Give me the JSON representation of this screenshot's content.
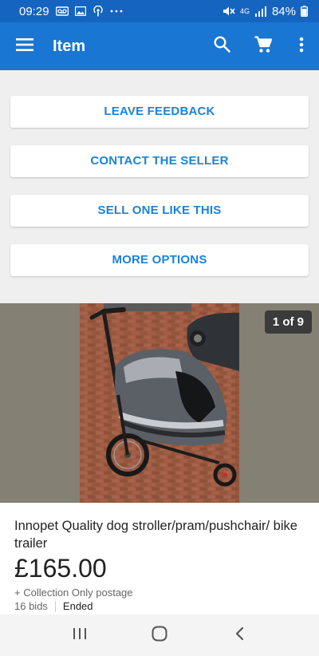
{
  "status_bar": {
    "time": "09:29",
    "battery": "84%",
    "network": "4G",
    "left_icons": [
      "voicemail-icon",
      "gallery-icon",
      "podcast-icon",
      "more-dots-icon"
    ],
    "right_icons": [
      "mute-icon",
      "signal-icon",
      "battery-icon"
    ]
  },
  "app_bar": {
    "title": "Item",
    "icons": [
      "menu-icon",
      "search-icon",
      "cart-icon",
      "more-vert-icon"
    ]
  },
  "options": [
    {
      "label": "LEAVE FEEDBACK"
    },
    {
      "label": "CONTACT THE SELLER"
    },
    {
      "label": "SELL ONE LIKE THIS"
    },
    {
      "label": "MORE OPTIONS"
    }
  ],
  "gallery": {
    "counter": "1 of 9",
    "current": 1,
    "total": 9
  },
  "item": {
    "title": "Innopet Quality dog stroller/pram/pushchair/ bike trailer",
    "price": "£165.00",
    "postage": "+ Collection Only postage",
    "bids": "16 bids",
    "status": "Ended"
  },
  "nav_bar": {
    "icons": [
      "recent-apps-icon",
      "home-icon",
      "back-icon"
    ]
  },
  "colors": {
    "status_bar": "#1565c0",
    "app_bar": "#1976d2",
    "accent_text": "#1a83d8",
    "panel_bg": "#efefef"
  }
}
